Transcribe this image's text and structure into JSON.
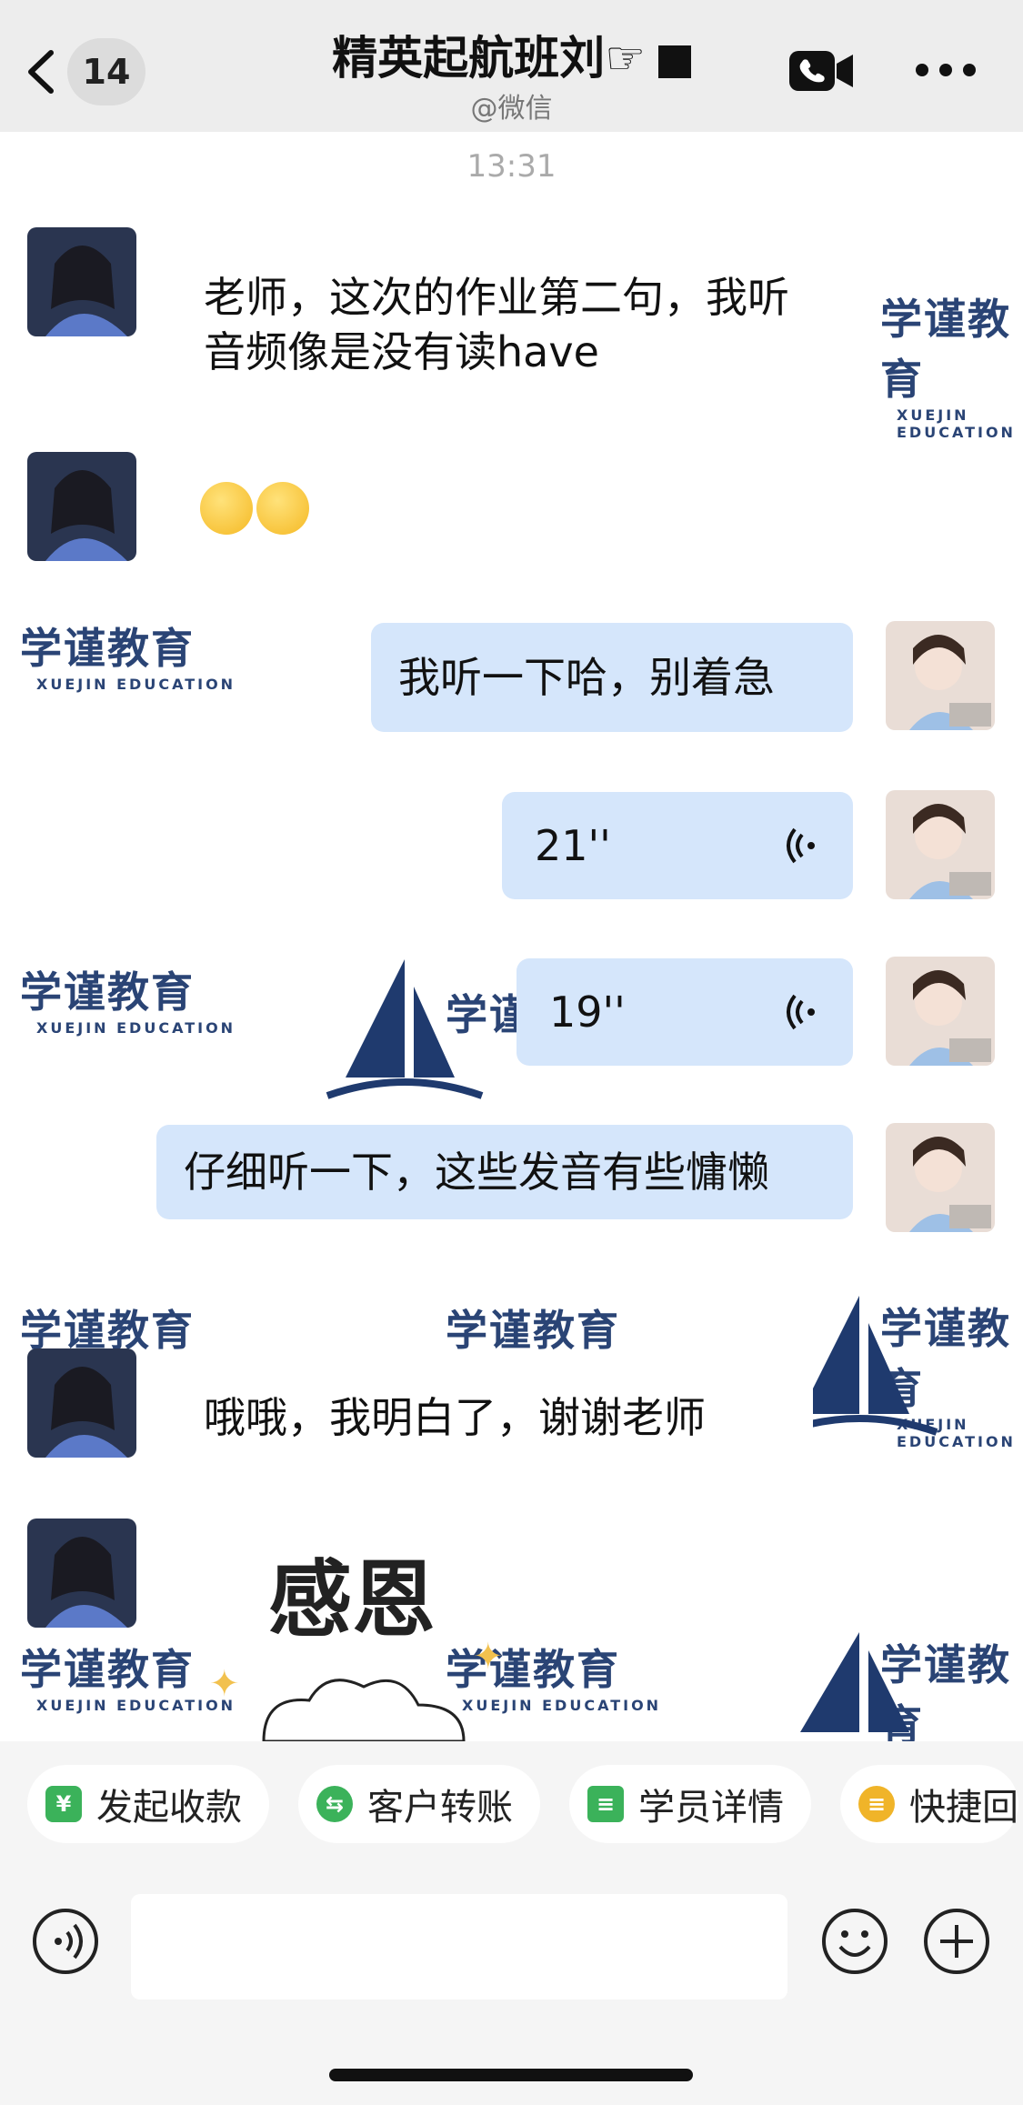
{
  "header": {
    "back_badge": "14",
    "title": "精英起航班刘",
    "title_cursor": "☞",
    "subtitle": "@微信"
  },
  "chat": {
    "timestamp": "13:31",
    "watermark": {
      "cn": "学谨教育",
      "en": "XUEJIN EDUCATION"
    },
    "messages": [
      {
        "side": "in",
        "text": "老师，这次的作业第二句，我听音频像是没有读have"
      },
      {
        "side": "in",
        "type": "emoji",
        "emoji": [
          "tears-of-frustration-emoji",
          "tears-of-frustration-emoji"
        ]
      },
      {
        "side": "out",
        "text": "我听一下哈，别着急"
      },
      {
        "side": "out",
        "type": "voice",
        "duration": "21''"
      },
      {
        "side": "out",
        "type": "voice",
        "duration": "19''"
      },
      {
        "side": "out",
        "text": "仔细听一下，这些发音有些慵懒"
      },
      {
        "side": "in",
        "text": "哦哦，我明白了，谢谢老师"
      },
      {
        "side": "in",
        "type": "sticker",
        "sticker_text": "感恩"
      }
    ]
  },
  "quick_actions": [
    {
      "label": "发起收款",
      "icon": "yen-shield-icon",
      "color": "#3bb25a"
    },
    {
      "label": "客户转账",
      "icon": "transfer-icon",
      "color": "#3bb25a"
    },
    {
      "label": "学员详情",
      "icon": "person-detail-icon",
      "color": "#3bb25a"
    },
    {
      "label": "快捷回",
      "icon": "quick-reply-icon",
      "color": "#f0b429"
    }
  ],
  "input": {
    "placeholder": ""
  },
  "colors": {
    "out_bubble": "#d5e6fb",
    "header_bg": "#ededed",
    "watermark": "#1f3a6e"
  }
}
